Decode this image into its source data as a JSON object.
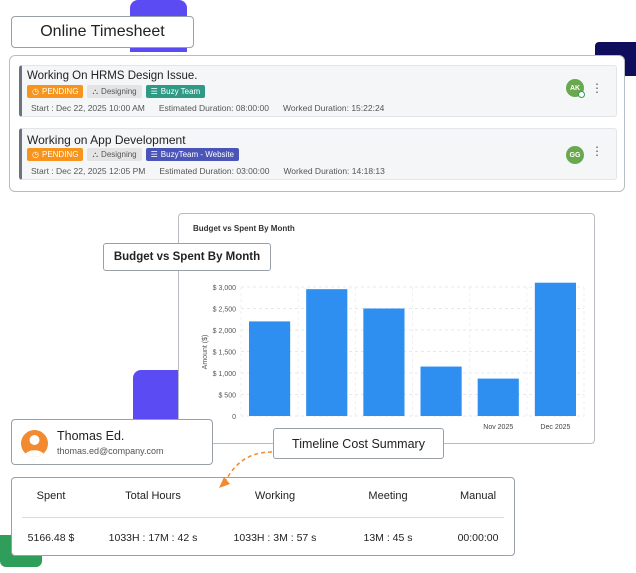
{
  "header": {
    "title": "Online Timesheet"
  },
  "entries": [
    {
      "title": "Working On HRMS Design Issue.",
      "status": "PENDING",
      "category": "Designing",
      "team": "Buzy Team",
      "start": "Start : Dec 22, 2025 10:00 AM",
      "estimated": "Estimated Duration: 08:00:00",
      "worked": "Worked Duration: 15:22:24",
      "avatar": "AK",
      "avatar_color": "#6aa84f"
    },
    {
      "title": "Working on App Development",
      "status": "PENDING",
      "category": "Designing",
      "team": "BuzyTeam - Website",
      "start": "Start : Dec 22, 2025 12:05 PM",
      "estimated": "Estimated Duration: 03:00:00",
      "worked": "Worked Duration: 14:18:13",
      "avatar": "GG",
      "avatar_color": "#5a9e3a"
    }
  ],
  "chart_card": {
    "small_title": "Budget vs Spent By Month",
    "label": "Budget vs Spent By Month"
  },
  "chart_data": {
    "type": "bar",
    "title": "Budget vs Spent By Month",
    "ylabel": "Amount ($)",
    "xlabel": "",
    "categories": [
      "",
      "",
      "",
      "",
      "Nov 2025",
      "Dec 2025"
    ],
    "values": [
      2200,
      2950,
      2500,
      1150,
      870,
      3100
    ],
    "yticks": [
      "0",
      "$ 500",
      "$ 1,000",
      "$ 1,500",
      "$ 2,000",
      "$ 2,500",
      "$ 3,000"
    ],
    "ylim": [
      0,
      3000
    ],
    "bar_color": "#2e8ff0",
    "grid": true
  },
  "user": {
    "name": "Thomas Ed.",
    "email": "thomas.ed@company.com"
  },
  "timeline": {
    "label": "Timeline Cost Summary"
  },
  "summary": {
    "headers": [
      "Spent",
      "Total Hours",
      "Working",
      "Meeting",
      "Manual"
    ],
    "values": [
      "5166.48 $",
      "1033H : 17M : 42 s",
      "1033H : 3M : 57 s",
      "13M : 45 s",
      "00:00:00"
    ]
  },
  "colors": {
    "accent_purple": "#5a4cf2",
    "navy": "#0e0e5c",
    "green": "#2f9e5a",
    "pending": "#f7941d",
    "arrow": "#f28b30"
  }
}
